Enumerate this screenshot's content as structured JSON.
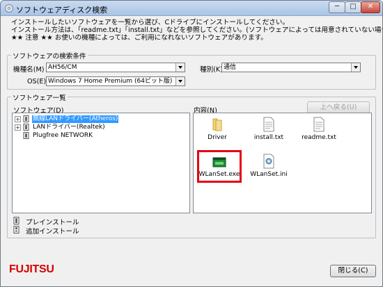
{
  "window": {
    "title": "ソフトウェアディスク検索",
    "min_glyph": "─",
    "max_glyph": "□",
    "close_glyph": "✕"
  },
  "intro": {
    "line1": "インストールしたいソフトウェアを一覧から選び、Cドライブにインストールしてください。",
    "line2": "インストール方法は、「readme.txt」「install.txt」などを参照してください。(ソフトウェアによっては用意されていない場合もあります)",
    "line3": "★★ 注意 ★★ お使いの機種によっては、ご利用になれないソフトウェアがあります。"
  },
  "search": {
    "legend": "ソフトウェアの検索条件",
    "model_label": "機種名(M)",
    "model_value": "AH56/CM",
    "os_label": "OS(E)",
    "os_value": "Windows 7 Home Premium (64ビット版)",
    "type_label": "種別(K)",
    "type_value": "通信"
  },
  "list": {
    "legend": "ソフトウェア一覧",
    "software_label": "ソフトウェア(D)",
    "contents_label": "内容(N)",
    "up_button": "上へ戻る(U)",
    "tree": [
      {
        "label": "無線LANドライバー(Atheros)",
        "expandable": true,
        "selected": true
      },
      {
        "label": "LANドライバー(Realtek)",
        "expandable": true,
        "selected": false
      },
      {
        "label": "Plugfree NETWORK",
        "expandable": false,
        "selected": false
      }
    ],
    "files": [
      {
        "name": "Driver",
        "kind": "folder"
      },
      {
        "name": "install.txt",
        "kind": "text"
      },
      {
        "name": "readme.txt",
        "kind": "text"
      },
      {
        "name": "WLanSet.exe",
        "kind": "exe"
      },
      {
        "name": "WLanSet.ini",
        "kind": "ini"
      }
    ]
  },
  "legend_items": {
    "preinstall": "プレインストール",
    "additional": "追加インストール"
  },
  "footer": {
    "logo": "FUJITSU",
    "close_button": "閉じる(C)"
  },
  "colors": {
    "highlight": "#e60012",
    "selection": "#3399ff",
    "logo": "#d50000"
  }
}
